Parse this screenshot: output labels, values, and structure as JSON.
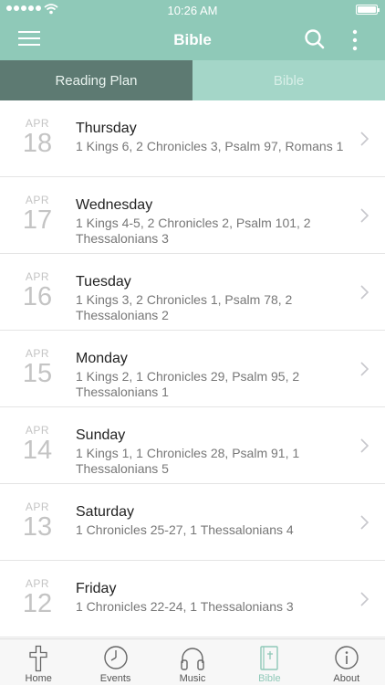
{
  "status_bar": {
    "time": "10:26 AM"
  },
  "navbar": {
    "title": "Bible",
    "icons": [
      "menu-icon",
      "search-icon",
      "more-vertical-icon"
    ]
  },
  "segments": {
    "reading_plan": "Reading Plan",
    "bible": "Bible",
    "active": "Reading Plan"
  },
  "readings": [
    {
      "month": "APR",
      "day": "18",
      "weekday": "Thursday",
      "passages": "1 Kings 6, 2 Chronicles 3, Psalm 97, Romans 1"
    },
    {
      "month": "APR",
      "day": "17",
      "weekday": "Wednesday",
      "passages": "1 Kings 4-5, 2 Chronicles 2, Psalm 101, 2 Thessalonians 3"
    },
    {
      "month": "APR",
      "day": "16",
      "weekday": "Tuesday",
      "passages": "1 Kings 3, 2 Chronicles 1, Psalm 78, 2 Thessalonians 2"
    },
    {
      "month": "APR",
      "day": "15",
      "weekday": "Monday",
      "passages": "1 Kings 2, 1 Chronicles 29, Psalm 95, 2 Thessalonians 1"
    },
    {
      "month": "APR",
      "day": "14",
      "weekday": "Sunday",
      "passages": "1 Kings 1, 1 Chronicles 28, Psalm 91, 1 Thessalonians 5"
    },
    {
      "month": "APR",
      "day": "13",
      "weekday": "Saturday",
      "passages": "1 Chronicles 25-27, 1 Thessalonians 4"
    },
    {
      "month": "APR",
      "day": "12",
      "weekday": "Friday",
      "passages": "1 Chronicles 22-24, 1 Thessalonians 3"
    }
  ],
  "tabbar": {
    "items": [
      {
        "label": "Home",
        "icon": "cross-icon"
      },
      {
        "label": "Events",
        "icon": "clock-icon"
      },
      {
        "label": "Music",
        "icon": "headphones-icon"
      },
      {
        "label": "Bible",
        "icon": "bible-icon"
      },
      {
        "label": "About",
        "icon": "info-icon"
      }
    ],
    "active": "Bible"
  },
  "colors": {
    "accent": "#8fc9b8",
    "active_segment": "#5d7a72",
    "inactive_segment": "#a4d6c8"
  }
}
